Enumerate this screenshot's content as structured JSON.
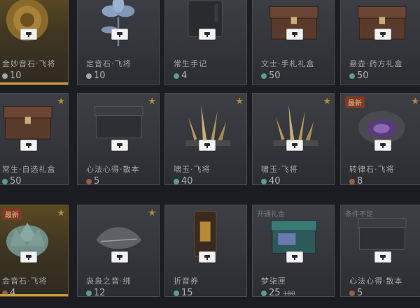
{
  "items": [
    {
      "name": "金妙音石·飞将",
      "count": "10",
      "icon": "pearl-currency-icon",
      "gold": true,
      "star": false,
      "label": "",
      "art": "ammonite-shell"
    },
    {
      "name": "定音石·飞将",
      "count": "10",
      "icon": "pearl-currency-icon",
      "gold": false,
      "star": false,
      "label": "",
      "art": "blue-flower"
    },
    {
      "name": "常生手记",
      "count": "4",
      "icon": "jade-currency-icon",
      "gold": false,
      "star": false,
      "label": "",
      "art": "book"
    },
    {
      "name": "文士·手札礼盒",
      "count": "50",
      "icon": "jade-currency-icon",
      "gold": false,
      "star": false,
      "label": "",
      "art": "wooden-chest"
    },
    {
      "name": "悬壶·药方礼盒",
      "count": "50",
      "icon": "jade-currency-icon",
      "gold": false,
      "star": false,
      "label": "",
      "art": "wooden-chest"
    },
    {
      "name": "常生·自选礼盒",
      "count": "50",
      "icon": "jade-currency-icon",
      "gold": false,
      "star": true,
      "label": "",
      "art": "wooden-chest"
    },
    {
      "name": "心法心得·散本",
      "count": "5",
      "icon": "copper-currency-icon",
      "gold": false,
      "star": true,
      "label": "",
      "art": "dark-box"
    },
    {
      "name": "啸玉·飞将",
      "count": "40",
      "icon": "jade-currency-icon",
      "gold": false,
      "star": true,
      "label": "",
      "art": "crystal"
    },
    {
      "name": "啸玉·飞将",
      "count": "40",
      "icon": "jade-currency-icon",
      "gold": false,
      "star": true,
      "label": "",
      "art": "crystal"
    },
    {
      "name": "转律石·飞将",
      "count": "8",
      "icon": "copper-currency-icon",
      "gold": false,
      "star": true,
      "label": "最新",
      "art": "geode"
    },
    {
      "name": "金音石·飞将",
      "count": "4",
      "icon": "copper-currency-icon",
      "gold": true,
      "star": true,
      "label": "最新",
      "art": "jade-lotus"
    },
    {
      "name": "袅袅之音·绑",
      "count": "12",
      "icon": "jade-currency-icon",
      "gold": false,
      "star": true,
      "label": "",
      "art": "silk-wrap"
    },
    {
      "name": "折音券",
      "count": "15",
      "icon": "jade-currency-icon",
      "gold": false,
      "star": false,
      "label": "",
      "art": "scroll"
    },
    {
      "name": "梦柒匣",
      "count": "25",
      "old": "180",
      "icon": "jade-currency-icon",
      "gold": false,
      "star": false,
      "label": "开通礼金",
      "art": "teal-box"
    },
    {
      "name": "心法心得·散本",
      "count": "5",
      "icon": "copper-currency-icon",
      "gold": false,
      "star": false,
      "label": "条件不足",
      "art": "dark-box"
    }
  ],
  "colors": {
    "jade": "#5f9e86",
    "pearl": "#9aa7a4",
    "copper": "#9a5d4a",
    "star": "#b08d3a"
  }
}
